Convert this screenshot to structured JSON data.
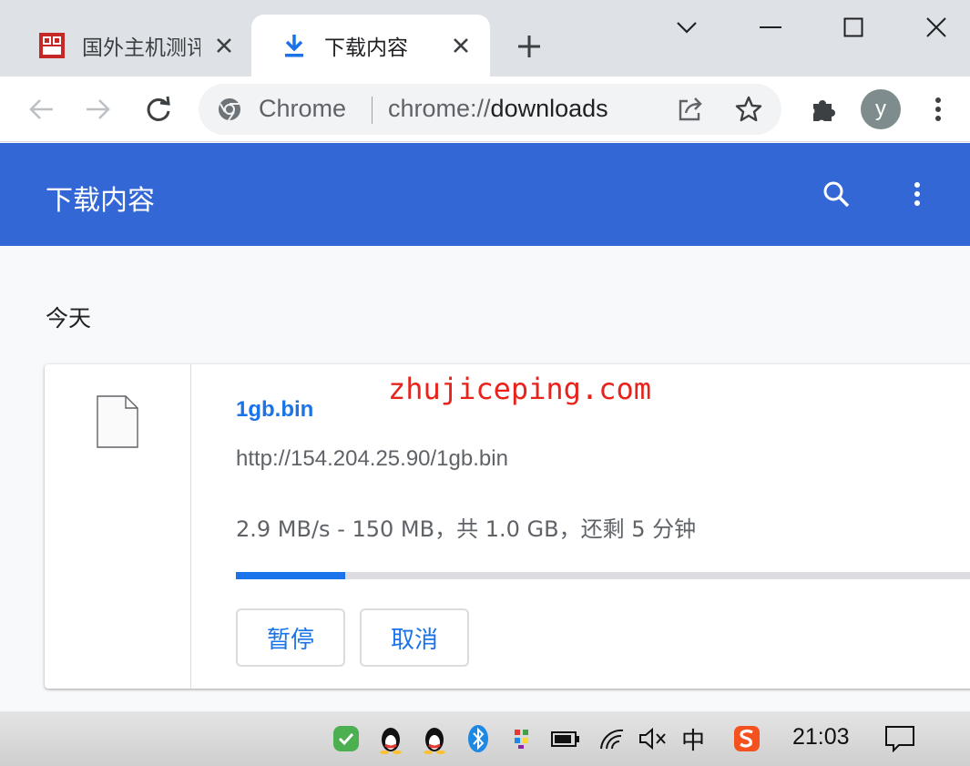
{
  "browser": {
    "tabs": [
      {
        "title": "国外主机测评",
        "active": false,
        "icon": "site-favicon-icon"
      },
      {
        "title": "下载内容",
        "active": true,
        "icon": "download-icon"
      }
    ],
    "window_controls": [
      "tab-search-icon",
      "minimize-icon",
      "maximize-icon",
      "close-icon"
    ],
    "omnibox": {
      "chip": "Chrome",
      "url_scheme": "chrome://",
      "url_host": "downloads"
    },
    "profile_initial": "y"
  },
  "page": {
    "title": "下载内容",
    "section_date": "今天",
    "download": {
      "file_name": "1gb.bin",
      "url": "http://154.204.25.90/1gb.bin",
      "progress_text": "2.9 MB/s - 150 MB，共 1.0 GB，还剩 5 分钟",
      "progress_fraction": 0.146,
      "pause_label": "暂停",
      "cancel_label": "取消"
    },
    "watermark": "zhujiceping.com"
  },
  "taskbar": {
    "ime_label": "中",
    "clock": "21:03"
  },
  "colors": {
    "header_blue": "#3367d6",
    "link_blue": "#1a73e8",
    "watermark_red": "#e8231c"
  }
}
